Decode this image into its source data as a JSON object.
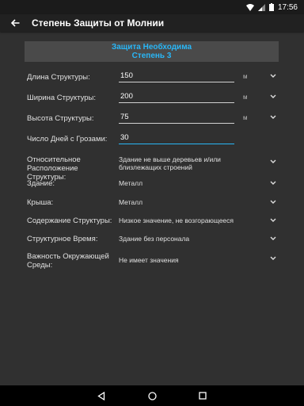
{
  "status": {
    "time": "17:56"
  },
  "appbar": {
    "title": "Степень Защиты от Молнии"
  },
  "banner": {
    "line1": "Защита Необходима",
    "line2": "Степень 3"
  },
  "fields": [
    {
      "label": "Длина Структуры:",
      "value": "150",
      "unit": "м"
    },
    {
      "label": "Ширина Структуры:",
      "value": "200",
      "unit": "м"
    },
    {
      "label": "Высота Структуры:",
      "value": "75",
      "unit": "м"
    },
    {
      "label": "Число Дней с Грозами:",
      "value": "30",
      "unit": ""
    }
  ],
  "selects": [
    {
      "label": "Относительное Расположение Структуры:",
      "value": "Здание не выше деревьев и/или близлежащих строений"
    },
    {
      "label": "Здание:",
      "value": "Металл"
    },
    {
      "label": "Крыша:",
      "value": "Металл"
    },
    {
      "label": "Содержание Структуры:",
      "value": "Низкое значение, не возгорающееся"
    },
    {
      "label": "Структурное Время:",
      "value": "Здание без персонала"
    },
    {
      "label": "Важность Окружающей Среды:",
      "value": "Не имеет значения"
    }
  ]
}
